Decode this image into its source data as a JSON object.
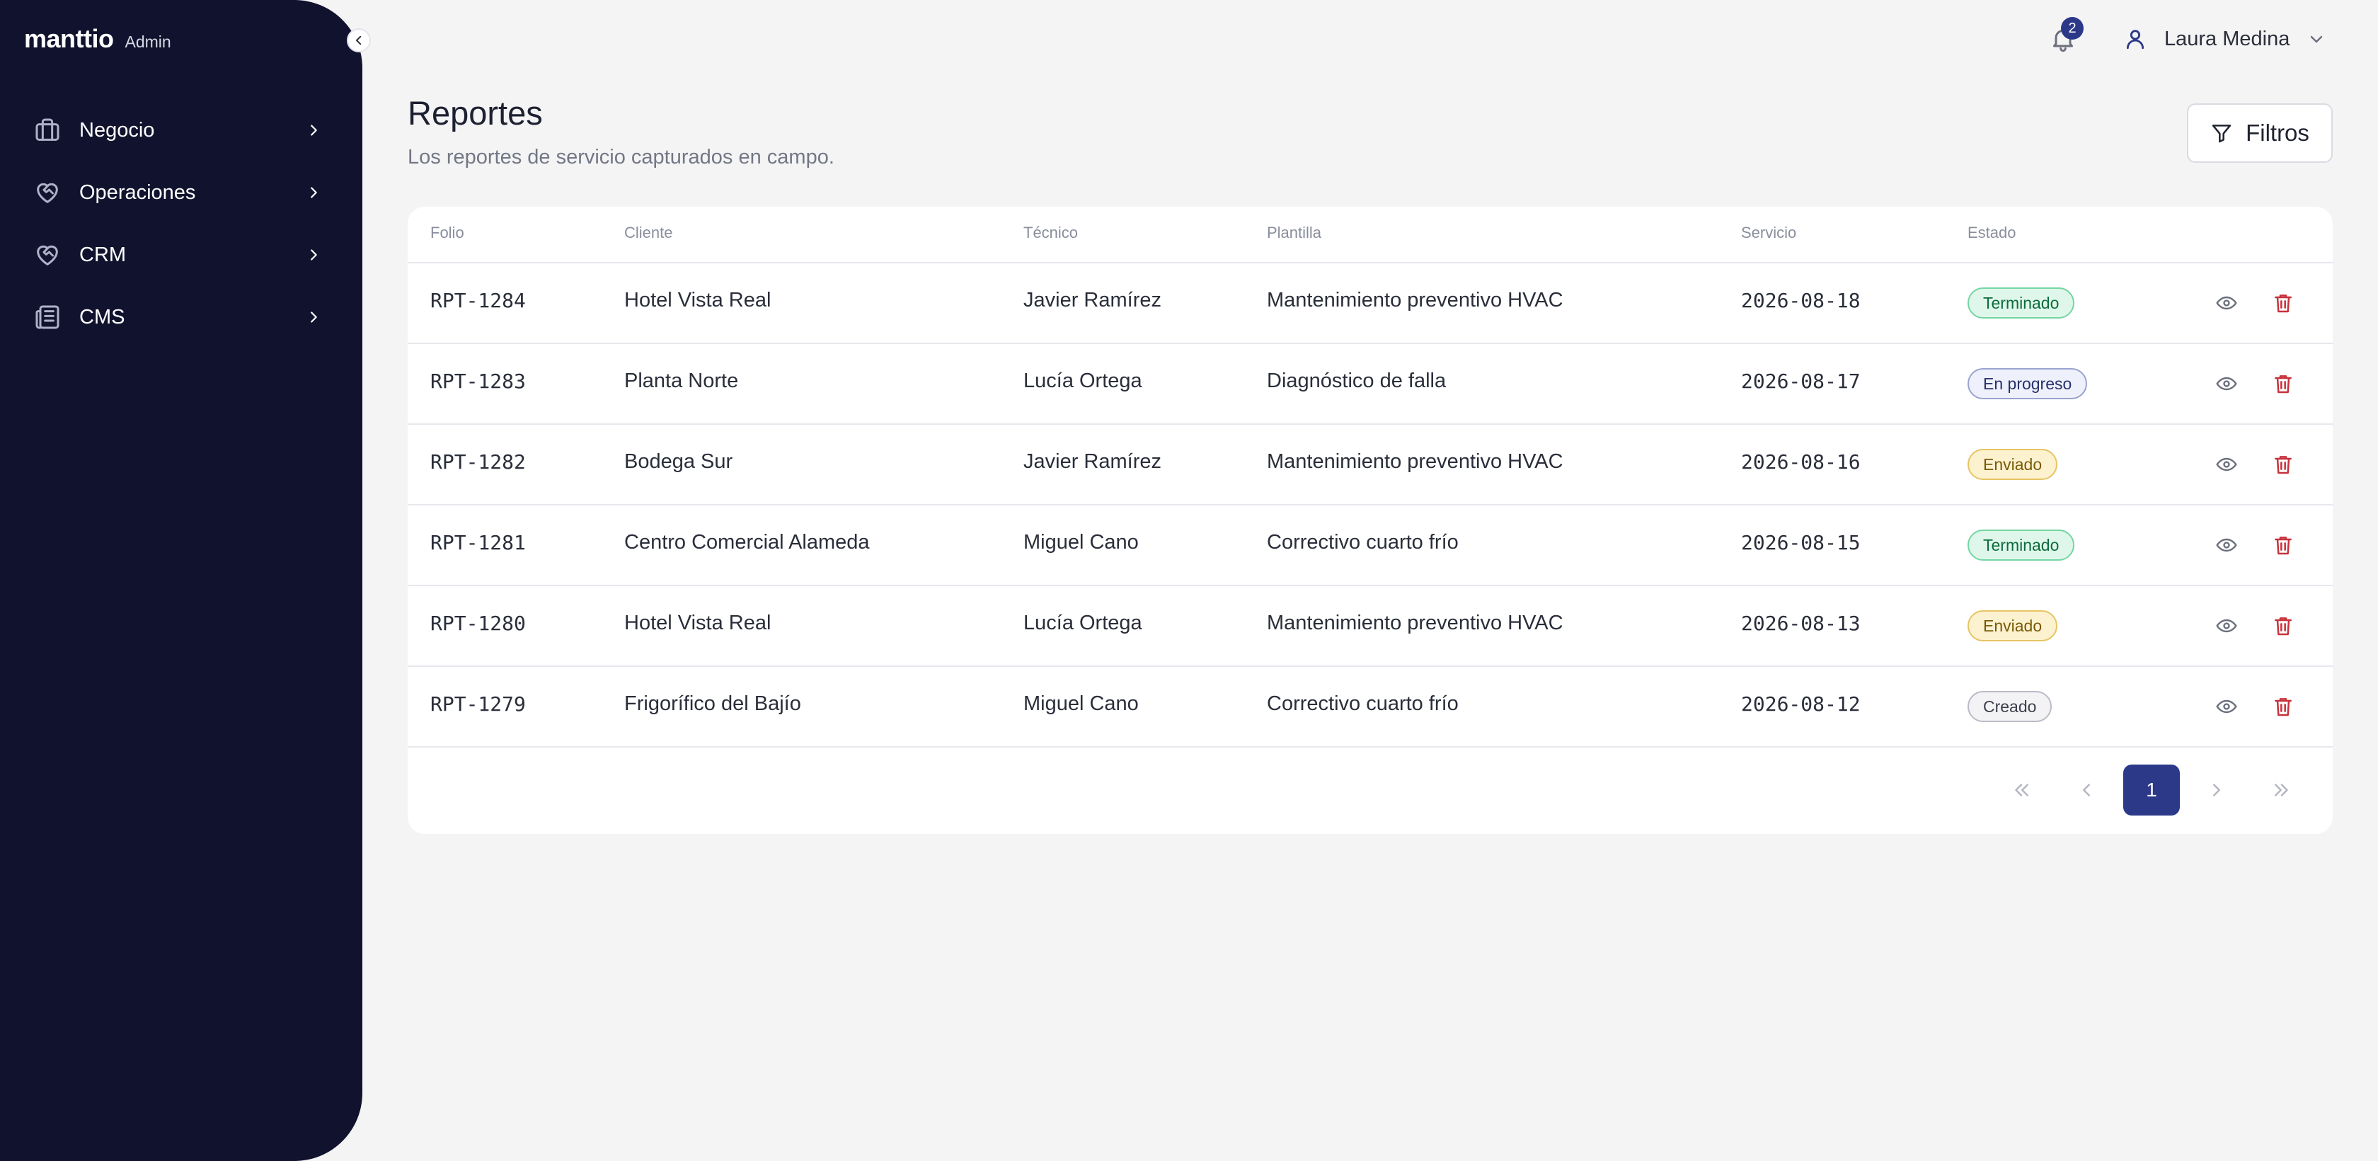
{
  "sidebar": {
    "brand": "manttio",
    "brand_tag": "Admin",
    "items": [
      {
        "label": "Negocio",
        "icon": "briefcase-icon"
      },
      {
        "label": "Operaciones",
        "icon": "heart-handshake-icon"
      },
      {
        "label": "CRM",
        "icon": "heart-handshake-icon"
      },
      {
        "label": "CMS",
        "icon": "newspaper-icon"
      }
    ]
  },
  "topbar": {
    "notifications_count": "2",
    "user_name": "Laura Medina"
  },
  "header": {
    "title": "Reportes",
    "subtitle": "Los reportes de servicio capturados en campo.",
    "filters_label": "Filtros"
  },
  "table": {
    "columns": [
      "Folio",
      "Cliente",
      "Técnico",
      "Plantilla",
      "Servicio",
      "Estado"
    ],
    "rows": [
      {
        "folio": "RPT-1284",
        "cliente": "Hotel Vista Real",
        "tecnico": "Javier Ramírez",
        "plantilla": "Mantenimiento preventivo HVAC",
        "servicio": "2026-08-18",
        "estado": "Terminado",
        "estado_kind": "done"
      },
      {
        "folio": "RPT-1283",
        "cliente": "Planta Norte",
        "tecnico": "Lucía Ortega",
        "plantilla": "Diagnóstico de falla",
        "servicio": "2026-08-17",
        "estado": "En progreso",
        "estado_kind": "progress"
      },
      {
        "folio": "RPT-1282",
        "cliente": "Bodega Sur",
        "tecnico": "Javier Ramírez",
        "plantilla": "Mantenimiento preventivo HVAC",
        "servicio": "2026-08-16",
        "estado": "Enviado",
        "estado_kind": "sent"
      },
      {
        "folio": "RPT-1281",
        "cliente": "Centro Comercial Alameda",
        "tecnico": "Miguel Cano",
        "plantilla": "Correctivo cuarto frío",
        "servicio": "2026-08-15",
        "estado": "Terminado",
        "estado_kind": "done"
      },
      {
        "folio": "RPT-1280",
        "cliente": "Hotel Vista Real",
        "tecnico": "Lucía Ortega",
        "plantilla": "Mantenimiento preventivo HVAC",
        "servicio": "2026-08-13",
        "estado": "Enviado",
        "estado_kind": "sent"
      },
      {
        "folio": "RPT-1279",
        "cliente": "Frigorífico del Bajío",
        "tecnico": "Miguel Cano",
        "plantilla": "Correctivo cuarto frío",
        "servicio": "2026-08-12",
        "estado": "Creado",
        "estado_kind": "created"
      }
    ]
  },
  "pagination": {
    "current_page": "1"
  },
  "colors": {
    "sidebar_bg": "#11132e",
    "accent": "#2c3989",
    "delete_icon": "#c8323c"
  }
}
